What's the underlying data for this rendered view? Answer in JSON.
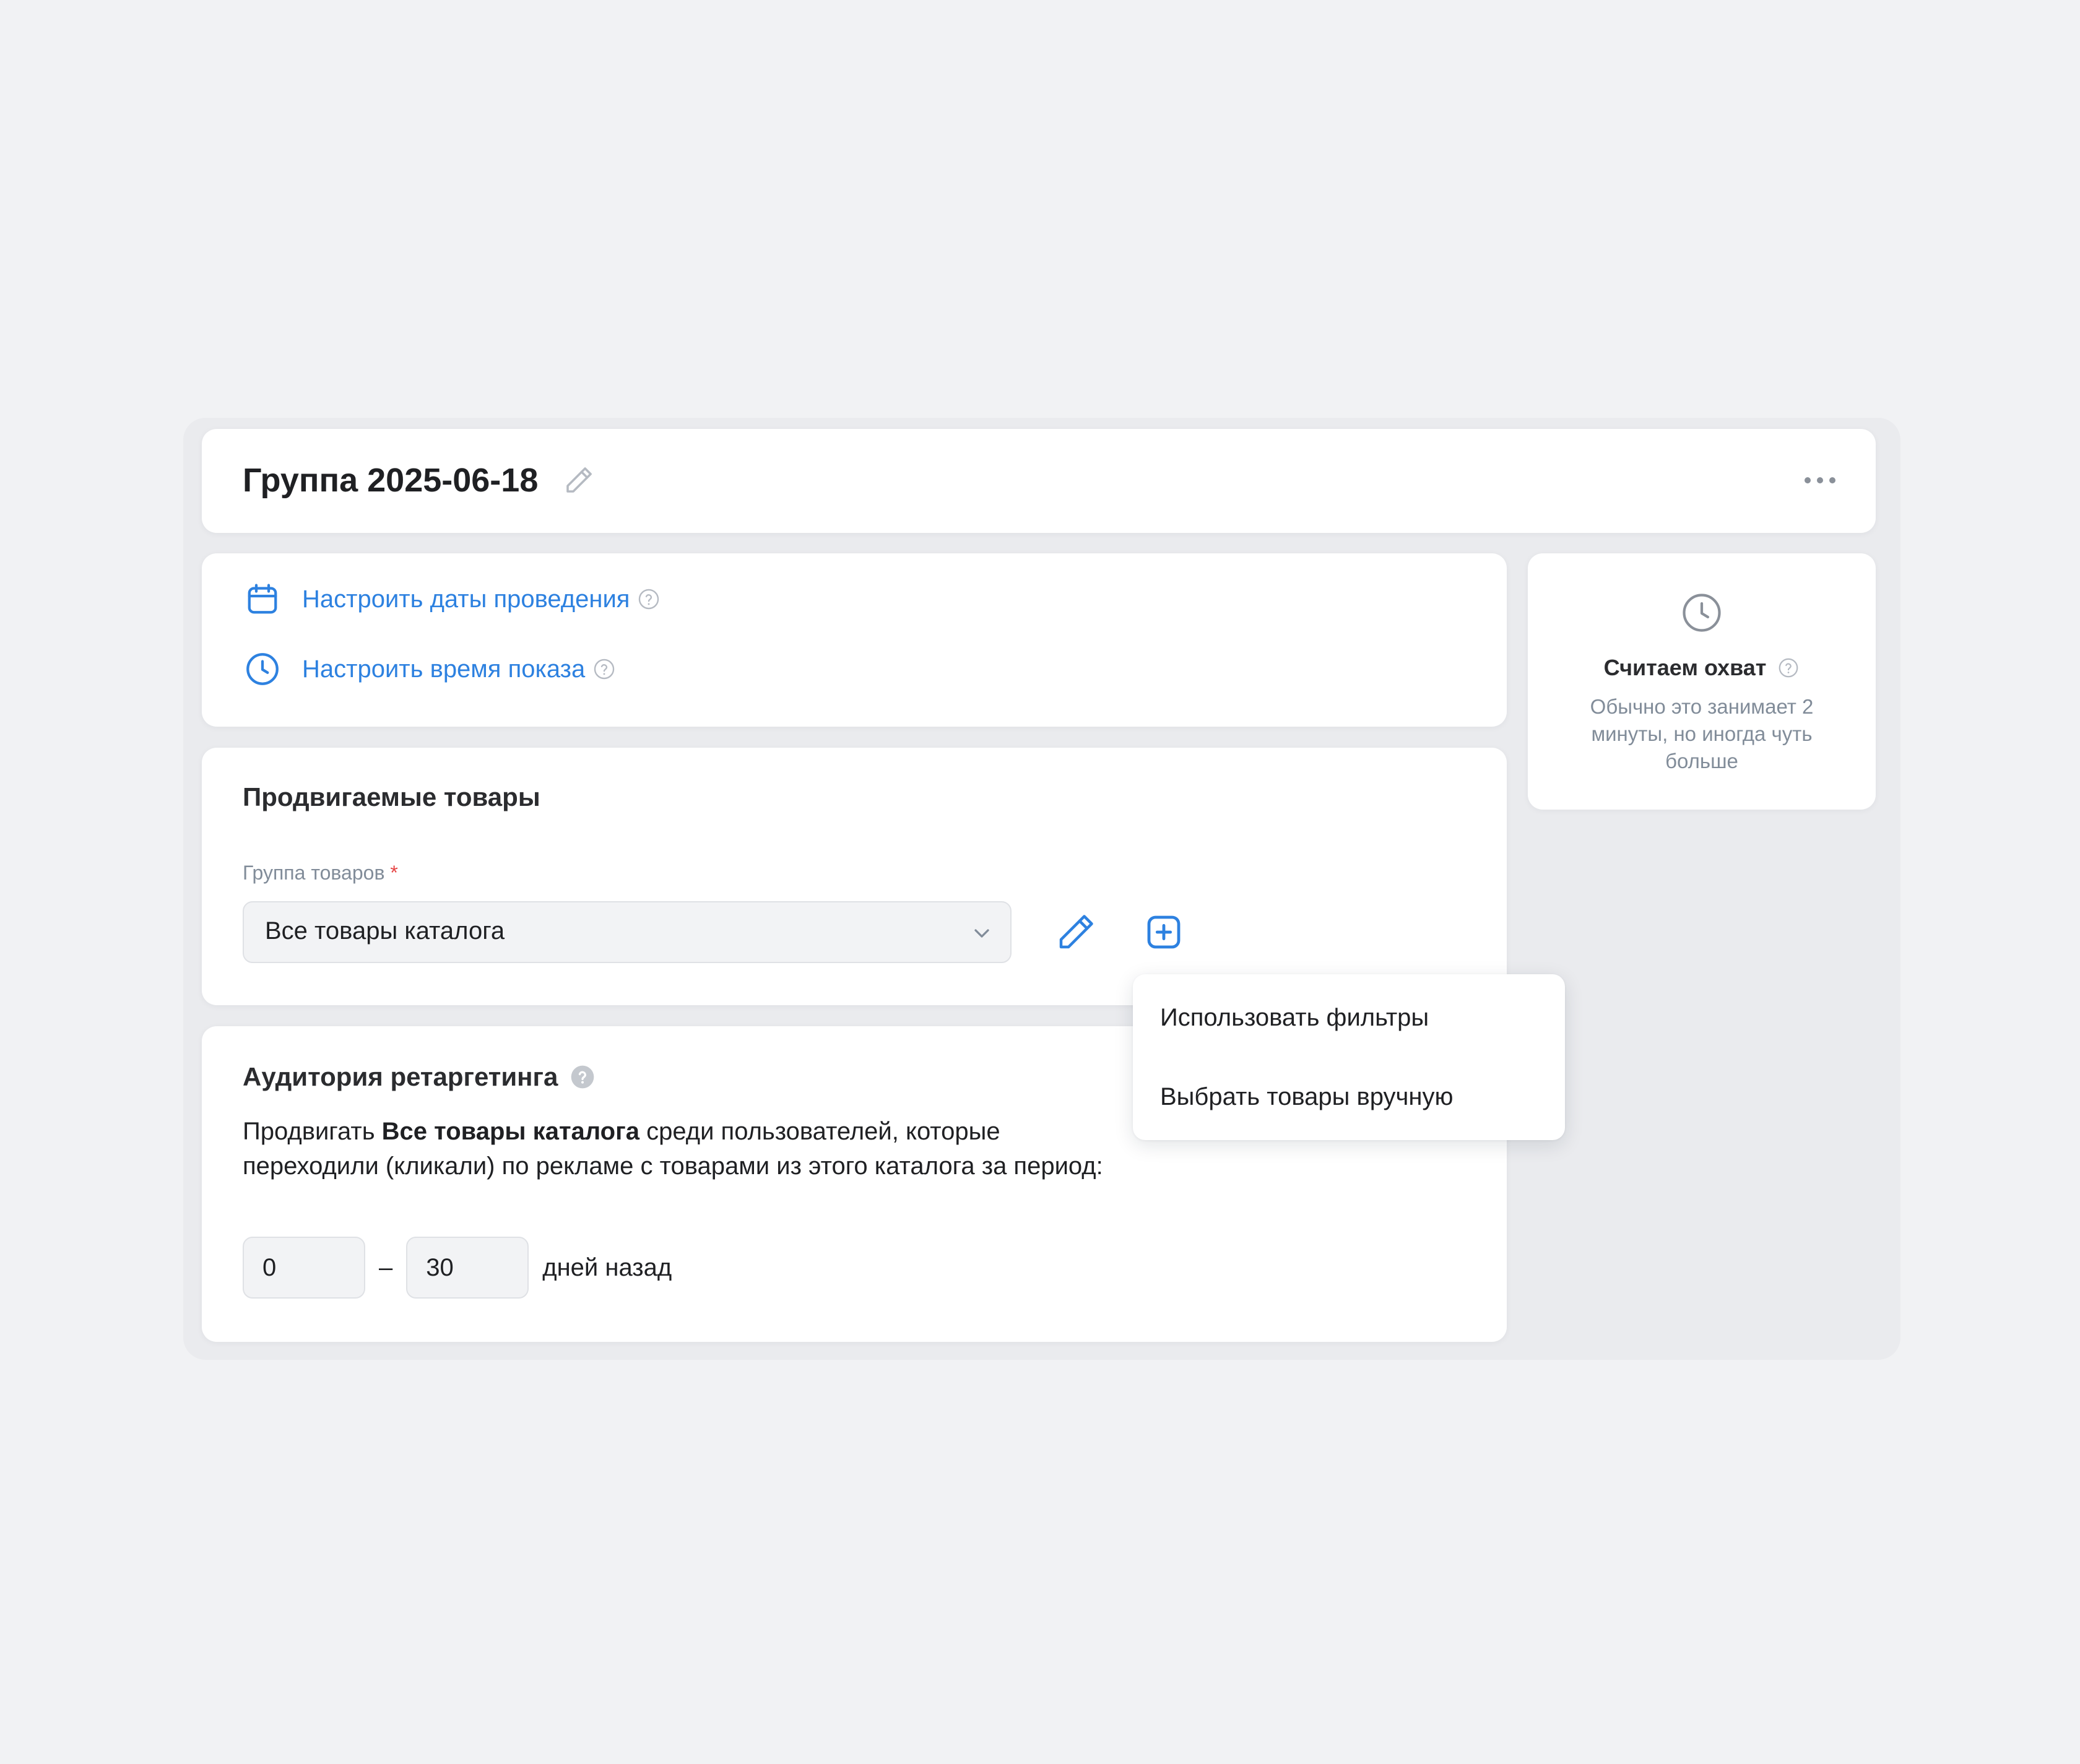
{
  "header": {
    "title": "Группа 2025-06-18",
    "edit_icon": "pencil-icon",
    "more_icon": "more-horizontal-icon"
  },
  "schedule": {
    "dates_link": "Настроить даты проведения",
    "dates_icon": "calendar-icon",
    "time_link": "Настроить время показа",
    "time_icon": "clock-icon"
  },
  "reach": {
    "icon": "clock-icon",
    "title": "Считаем охват",
    "description": "Обычно это занимает 2 минуты, но иногда чуть больше"
  },
  "products": {
    "title": "Продвигаемые товары",
    "field_label": "Группа товаров",
    "required_mark": "*",
    "selected_value": "Все товары каталога",
    "edit_icon": "pencil-icon",
    "add_icon": "plus-square-icon"
  },
  "retargeting": {
    "title": "Аудитория ретаргетинга",
    "desc_prefix": "Продвигать",
    "desc_bold": "Все товары каталога",
    "desc_suffix": "среди пользователей, которые переходили (кликали) по рекламе с товарами из этого каталога за период:",
    "range_from": "0",
    "range_to": "30",
    "range_dash": "–",
    "range_suffix": "дней назад"
  },
  "menu": {
    "items": [
      {
        "label": "Использовать фильтры"
      },
      {
        "label": "Выбрать товары вручную"
      }
    ]
  },
  "colors": {
    "accent": "#2d81e0",
    "page_bg": "#f1f2f4",
    "secondary_text": "#818c99"
  }
}
